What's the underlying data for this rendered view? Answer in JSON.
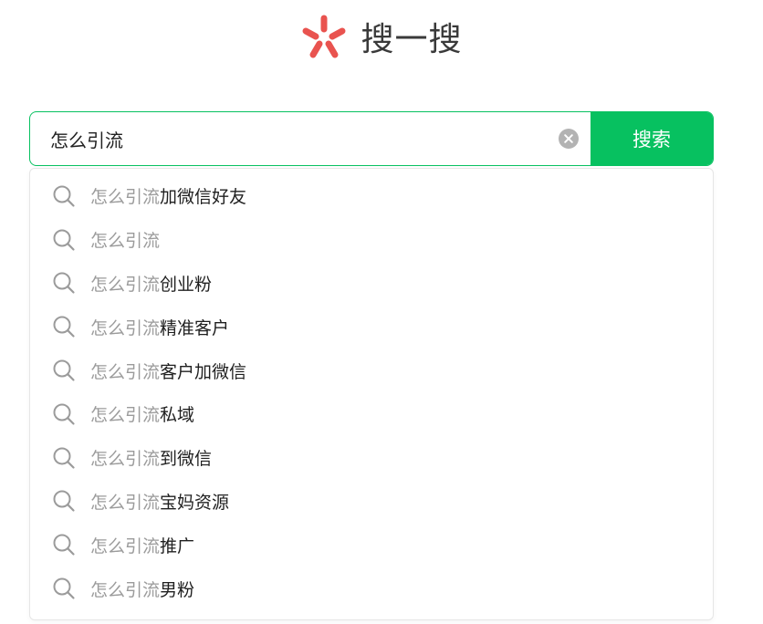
{
  "brand": {
    "title": "搜一搜",
    "logo_icon": "sousuo-logo-icon",
    "logo_color": "#e9534f"
  },
  "search": {
    "value": "怎么引流",
    "clear_icon": "clear-circle-icon",
    "button_label": "搜索",
    "accent_color": "#07c160"
  },
  "suggestions": [
    {
      "match": "怎么引流",
      "rest": "加微信好友"
    },
    {
      "match": "怎么引流",
      "rest": ""
    },
    {
      "match": "怎么引流",
      "rest": "创业粉"
    },
    {
      "match": "怎么引流",
      "rest": "精准客户"
    },
    {
      "match": "怎么引流",
      "rest": "客户加微信"
    },
    {
      "match": "怎么引流",
      "rest": "私域"
    },
    {
      "match": "怎么引流",
      "rest": "到微信"
    },
    {
      "match": "怎么引流",
      "rest": "宝妈资源"
    },
    {
      "match": "怎么引流",
      "rest": "推广"
    },
    {
      "match": "怎么引流",
      "rest": "男粉"
    }
  ]
}
